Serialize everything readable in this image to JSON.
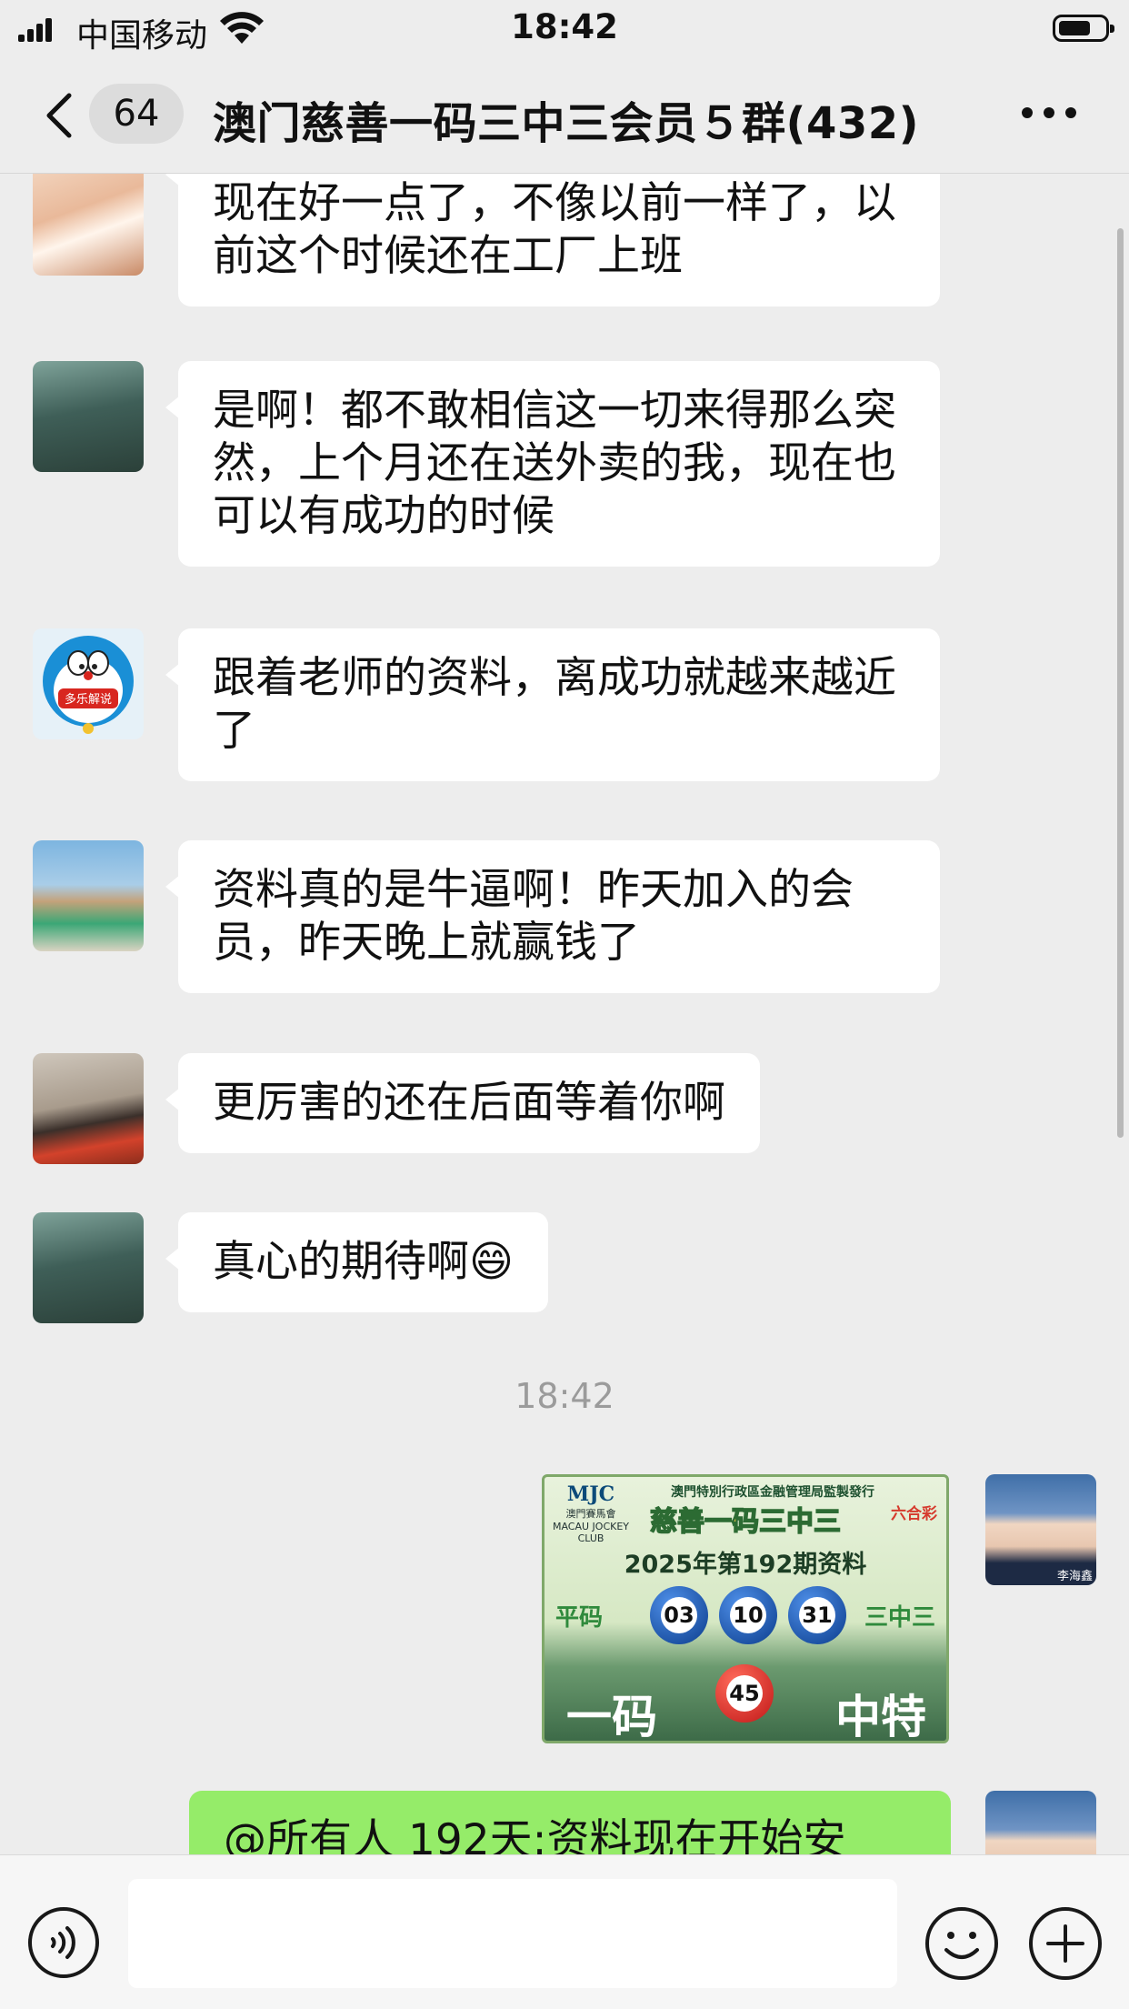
{
  "status_bar": {
    "carrier": "中国移动",
    "time": "18:42"
  },
  "nav": {
    "unread_count": "64",
    "title": "澳门慈善一码三中三会员５群(432)"
  },
  "messages": [
    {
      "text": "现在好一点了，不像以前一样了，以前这个时候还在工厂上班"
    },
    {
      "text": "是啊！都不敢相信这一切来得那么突然，上个月还在送外卖的我，现在也可以有成功的时候"
    },
    {
      "text": "跟着老师的资料，离成功就越来越近了"
    },
    {
      "text": "资料真的是牛逼啊！昨天加入的会员，昨天晚上就赢钱了"
    },
    {
      "text": "更厉害的还在后面等着你啊"
    },
    {
      "text": "真心的期待啊😄"
    }
  ],
  "timestamp": "18:42",
  "image_card": {
    "header": "澳門特別行政區金融管理局監製發行",
    "logo_mark": "MJC",
    "logo_text": "澳門賽馬會 MACAU JOCKEY CLUB",
    "brand": "六合彩",
    "title": "慈善一码三中三",
    "issue": "2025年第192期资料",
    "ping_label": "平码",
    "balls": [
      "03",
      "10",
      "31"
    ],
    "sanzhong_label": "三中三",
    "yima_label": "一码",
    "special_ball": "45",
    "zhongte_label": "中特"
  },
  "sent_avatar_name": "李海鑫",
  "outgoing_text": "@所有人 192天:资料现在开始安",
  "avatar_badge": "多乐解说",
  "input": {
    "placeholder": ""
  },
  "colors": {
    "background": "#ededed",
    "bubble_in": "#ffffff",
    "bubble_out": "#95ec69"
  }
}
